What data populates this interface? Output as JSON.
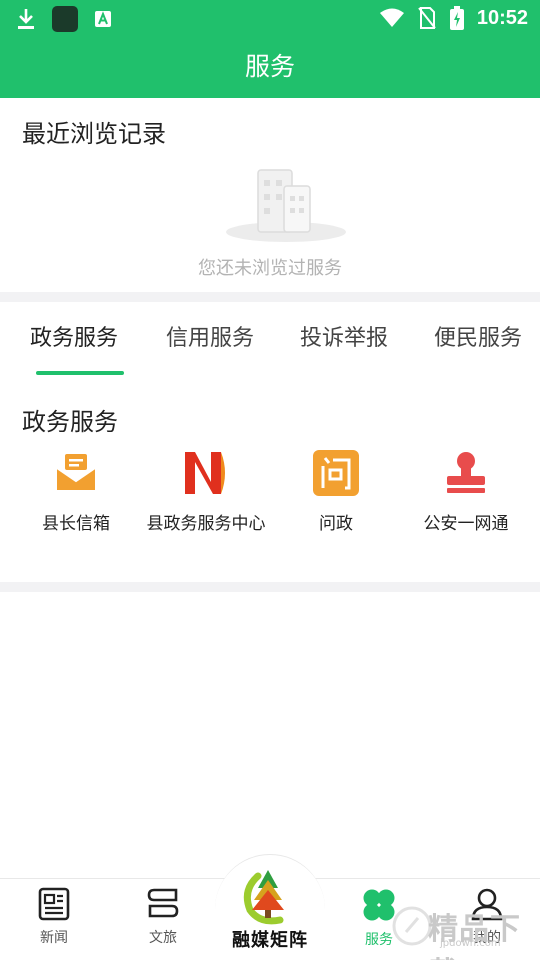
{
  "status_bar": {
    "time": "10:52",
    "icons": [
      "download-icon",
      "app-icon",
      "font-icon",
      "wifi-icon",
      "no-signal-icon",
      "battery-charging-icon"
    ]
  },
  "header": {
    "title": "服务"
  },
  "recent": {
    "title": "最近浏览记录",
    "empty_text": "您还未浏览过服务"
  },
  "tabs": [
    {
      "label": "政务服务",
      "active": true
    },
    {
      "label": "信用服务",
      "active": false
    },
    {
      "label": "投诉举报",
      "active": false
    },
    {
      "label": "便民服务",
      "active": false
    }
  ],
  "services": {
    "title": "政务服务",
    "items": [
      {
        "label": "县长信箱",
        "icon": "mailbox-icon",
        "color": "#f2a030"
      },
      {
        "label": "县政务服务中心",
        "icon": "government-service-center-logo",
        "color": "#e0301e"
      },
      {
        "label": "问政",
        "icon": "ask-icon",
        "color": "#f2a030"
      },
      {
        "label": "公安一网通",
        "icon": "police-stamp-icon",
        "color": "#e84c4c"
      }
    ]
  },
  "bottom_nav": {
    "items": [
      {
        "label": "新闻",
        "icon": "newspaper-icon",
        "active": false
      },
      {
        "label": "文旅",
        "icon": "culture-travel-icon",
        "active": false
      },
      {
        "label": "融媒矩阵",
        "icon": "media-matrix-logo",
        "active": false
      },
      {
        "label": "服务",
        "icon": "clover-icon",
        "active": true
      },
      {
        "label": "我的",
        "icon": "user-icon",
        "active": false
      }
    ]
  },
  "watermark": {
    "text": "精品下载",
    "sub": "jpdown.com"
  },
  "colors": {
    "brand": "#20c06c",
    "divider": "#f2f2f4",
    "muted_text": "#b3b3b3"
  }
}
